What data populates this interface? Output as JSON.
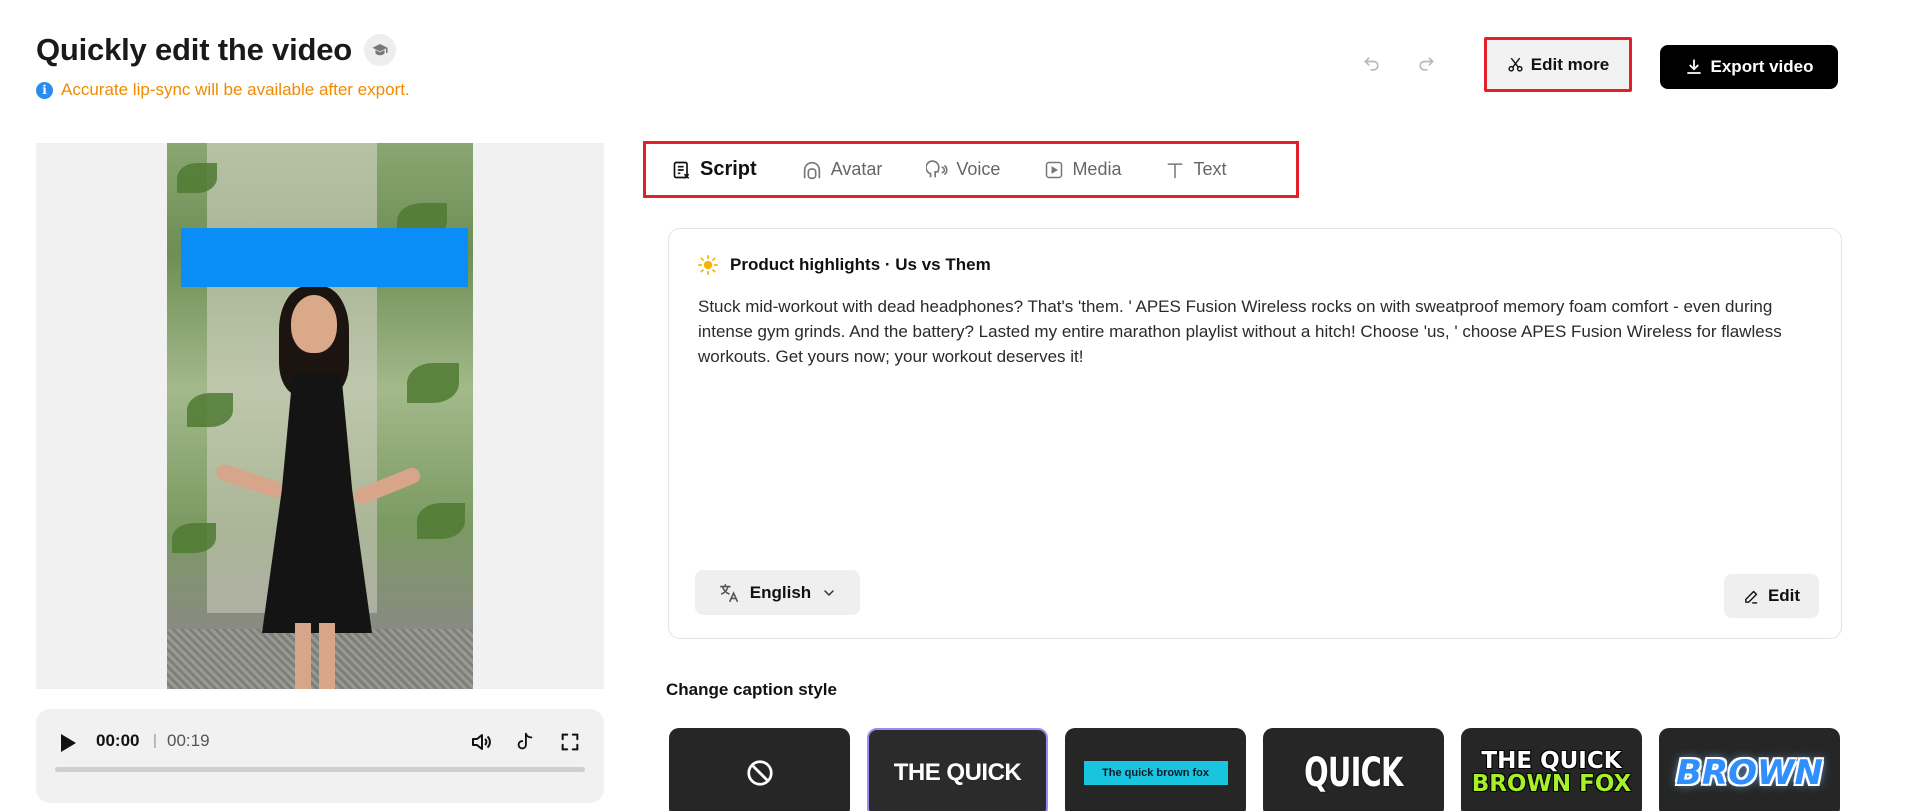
{
  "header": {
    "title": "Quickly edit the video",
    "notice": "Accurate lip-sync will be available after export.",
    "edit_more_label": "Edit more",
    "export_label": "Export video"
  },
  "player": {
    "current_time": "00:00",
    "separator": "|",
    "total_time": "00:19",
    "progress": 0
  },
  "tabs": [
    {
      "label": "Script",
      "active": true
    },
    {
      "label": "Avatar",
      "active": false
    },
    {
      "label": "Voice",
      "active": false
    },
    {
      "label": "Media",
      "active": false
    },
    {
      "label": "Text",
      "active": false
    }
  ],
  "script": {
    "heading": "Product highlights · Us vs Them",
    "body": "Stuck mid-workout with dead headphones? That's 'them. ' APES Fusion Wireless rocks on with sweatproof memory foam comfort - even during intense gym grinds. And the battery? Lasted my entire marathon playlist without a hitch! Choose 'us, ' choose APES Fusion Wireless for flawless workouts. Get yours now; your workout deserves it!",
    "language": "English",
    "edit_label": "Edit"
  },
  "captions": {
    "title": "Change caption style",
    "styles": [
      {
        "name": "none",
        "sample": ""
      },
      {
        "name": "the-quick",
        "sample": "THE QUICK"
      },
      {
        "name": "quick-brown-fox-banner",
        "sample": "The quick brown fox"
      },
      {
        "name": "quick-impact",
        "sample": "QUICK"
      },
      {
        "name": "quick-brown-fox-combo",
        "sample_line1": "THE QUICK",
        "sample_line2": "BROWN FOX"
      },
      {
        "name": "brown-glow",
        "sample": "BROWN"
      }
    ]
  },
  "colors": {
    "accent_highlight": "#e3202a",
    "notice": "#f08a00",
    "info": "#2a8cf0",
    "caption_bar": "#0a8ef5"
  }
}
